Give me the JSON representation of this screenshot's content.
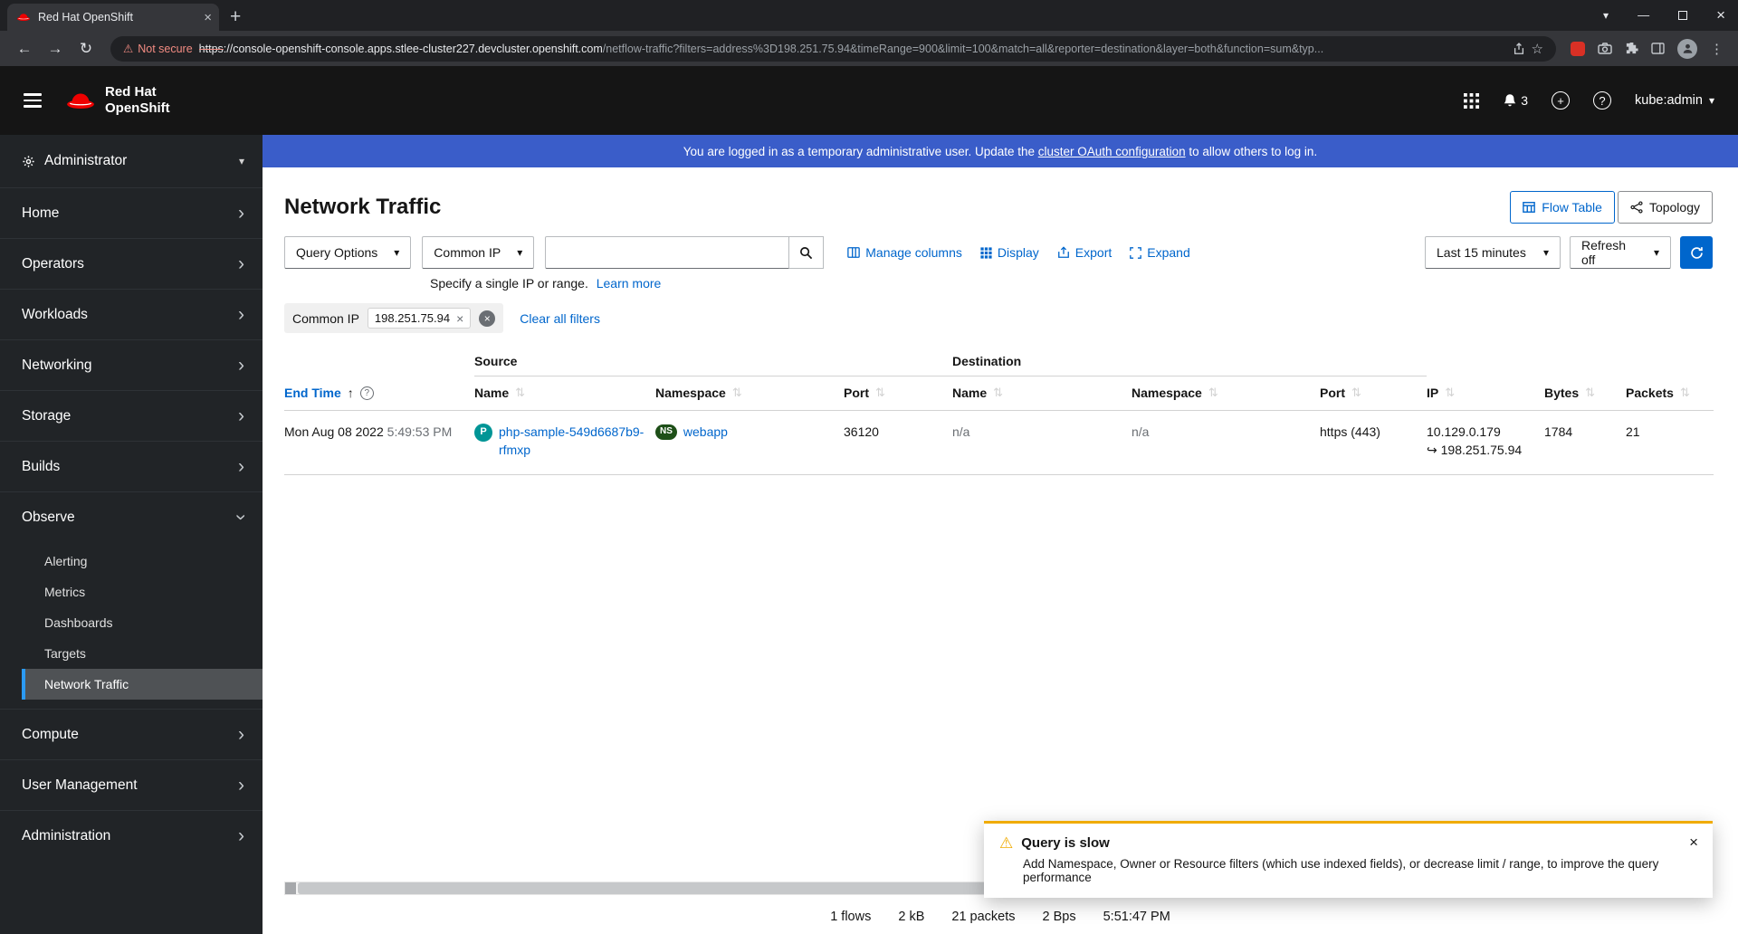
{
  "colors": {
    "accent_blue": "#0066cc",
    "banner_blue": "#3a5dc9",
    "warning_gold": "#f0ab00",
    "pod_badge_teal": "#009596",
    "namespace_badge_green": "#1e4f18",
    "nav_selected_border": "#2b9af3",
    "not_secure_red": "#f28b82",
    "brand_red": "#ee0000"
  },
  "icons": {
    "caret_down": "▾",
    "chevron_right": "›",
    "sort_inactive": "⇅",
    "sort_asc": "↑",
    "close": "×",
    "kebab": "⋮",
    "hook_arrow": "↪",
    "back_arrow": "←",
    "forward_arrow": "→",
    "reload": "↻",
    "warning": "⚠",
    "plus": "+",
    "question": "?",
    "minimize": "—",
    "star": "☆"
  },
  "browser": {
    "tab_title": "Red Hat OpenShift",
    "not_secure": "Not secure",
    "url_scheme": "https",
    "url_host": "://console-openshift-console.apps.stlee-cluster227.devcluster.openshift.com",
    "url_path": "/netflow-traffic?filters=address%3D198.251.75.94&timeRange=900&limit=100&match=all&reporter=destination&layer=both&function=sum&typ..."
  },
  "masthead": {
    "brand_top": "Red Hat",
    "brand_bottom": "OpenShift",
    "notification_count": "3",
    "user": "kube:admin"
  },
  "banner": {
    "prefix": "You are logged in as a temporary administrative user. Update the ",
    "link": "cluster OAuth configuration",
    "suffix": " to allow others to log in."
  },
  "sidebar": {
    "perspective": "Administrator",
    "items": [
      {
        "label": "Home"
      },
      {
        "label": "Operators"
      },
      {
        "label": "Workloads"
      },
      {
        "label": "Networking"
      },
      {
        "label": "Storage"
      },
      {
        "label": "Builds"
      },
      {
        "label": "Observe"
      },
      {
        "label": "Compute"
      },
      {
        "label": "User Management"
      },
      {
        "label": "Administration"
      }
    ],
    "observe_children": [
      {
        "label": "Alerting"
      },
      {
        "label": "Metrics"
      },
      {
        "label": "Dashboards"
      },
      {
        "label": "Targets"
      },
      {
        "label": "Network Traffic"
      }
    ]
  },
  "page": {
    "title": "Network Traffic",
    "flow_table_button": "Flow Table",
    "topology_button": "Topology"
  },
  "toolbar": {
    "query_options": "Query Options",
    "filter_type": "Common IP",
    "manage_columns": "Manage columns",
    "display": "Display",
    "export": "Export",
    "expand": "Expand",
    "time_range": "Last 15 minutes",
    "refresh_mode": "Refresh off",
    "hint": "Specify a single IP or range.",
    "hint_link": "Learn more"
  },
  "filters": {
    "group_label": "Common IP",
    "chip": "198.251.75.94",
    "clear_all": "Clear all filters"
  },
  "table": {
    "groups": {
      "source": "Source",
      "destination": "Destination"
    },
    "headers": {
      "end_time": "End Time",
      "name": "Name",
      "namespace": "Namespace",
      "port": "Port",
      "ip": "IP",
      "bytes": "Bytes",
      "packets": "Packets"
    },
    "row": {
      "date": "Mon Aug 08 2022",
      "time": "5:49:53 PM",
      "src_pod_badge": "P",
      "src_name": "php-sample-549d6687b9-rfmxp",
      "ns_badge": "NS",
      "src_namespace": "webapp",
      "src_port": "36120",
      "dst_name": "n/a",
      "dst_namespace": "n/a",
      "dst_port": "https (443)",
      "ip_src": "10.129.0.179",
      "ip_dst": "198.251.75.94",
      "bytes": "1784",
      "packets": "21"
    }
  },
  "statusbar": {
    "flows": "1 flows",
    "size": "2 kB",
    "packets": "21 packets",
    "rate": "2 Bps",
    "time": "5:51:47 PM"
  },
  "toast": {
    "title": "Query is slow",
    "message": "Add Namespace, Owner or Resource filters (which use indexed fields), or decrease limit / range, to improve the query performance"
  }
}
